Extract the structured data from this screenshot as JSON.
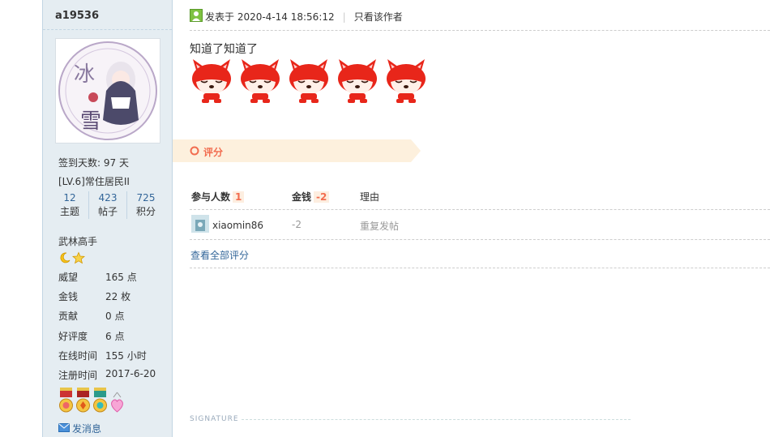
{
  "user": {
    "name": "a19536",
    "checkin": "签到天数: 97 天",
    "level": "[LV.6]常住居民II",
    "stats": [
      {
        "num": "12",
        "label": "主题"
      },
      {
        "num": "423",
        "label": "帖子"
      },
      {
        "num": "725",
        "label": "积分"
      }
    ],
    "group": "武林高手",
    "info": [
      {
        "key": "威望",
        "value": "165 点"
      },
      {
        "key": "金钱",
        "value": "22 枚"
      },
      {
        "key": "贡献",
        "value": "0 点"
      },
      {
        "key": "好评度",
        "value": "6 点"
      },
      {
        "key": "在线时间",
        "value": "155 小时"
      },
      {
        "key": "注册时间",
        "value": "2017-6-20"
      }
    ],
    "send_message": "发消息",
    "avatar_text_1": "冰",
    "avatar_text_2": "雪"
  },
  "post": {
    "posted_at": "发表于 2020-4-14 18:56:12",
    "author_only": "只看该作者",
    "content": "知道了知道了",
    "face_count": 5
  },
  "rating": {
    "section_label": "评分",
    "headers": {
      "participants": "参与人数",
      "participants_count": "1",
      "money": "金钱",
      "money_total": "-2",
      "reason": "理由"
    },
    "rows": [
      {
        "user": "xiaomin86",
        "money": "-2",
        "reason": "重复发帖"
      }
    ],
    "view_all": "查看全部评分"
  },
  "signature_label": "SIGNATURE",
  "colors": {
    "sidebar_bg": "#e5edf2",
    "accent": "#f26c4f",
    "link": "#336699",
    "rate_bar": "#fdf0dd"
  }
}
